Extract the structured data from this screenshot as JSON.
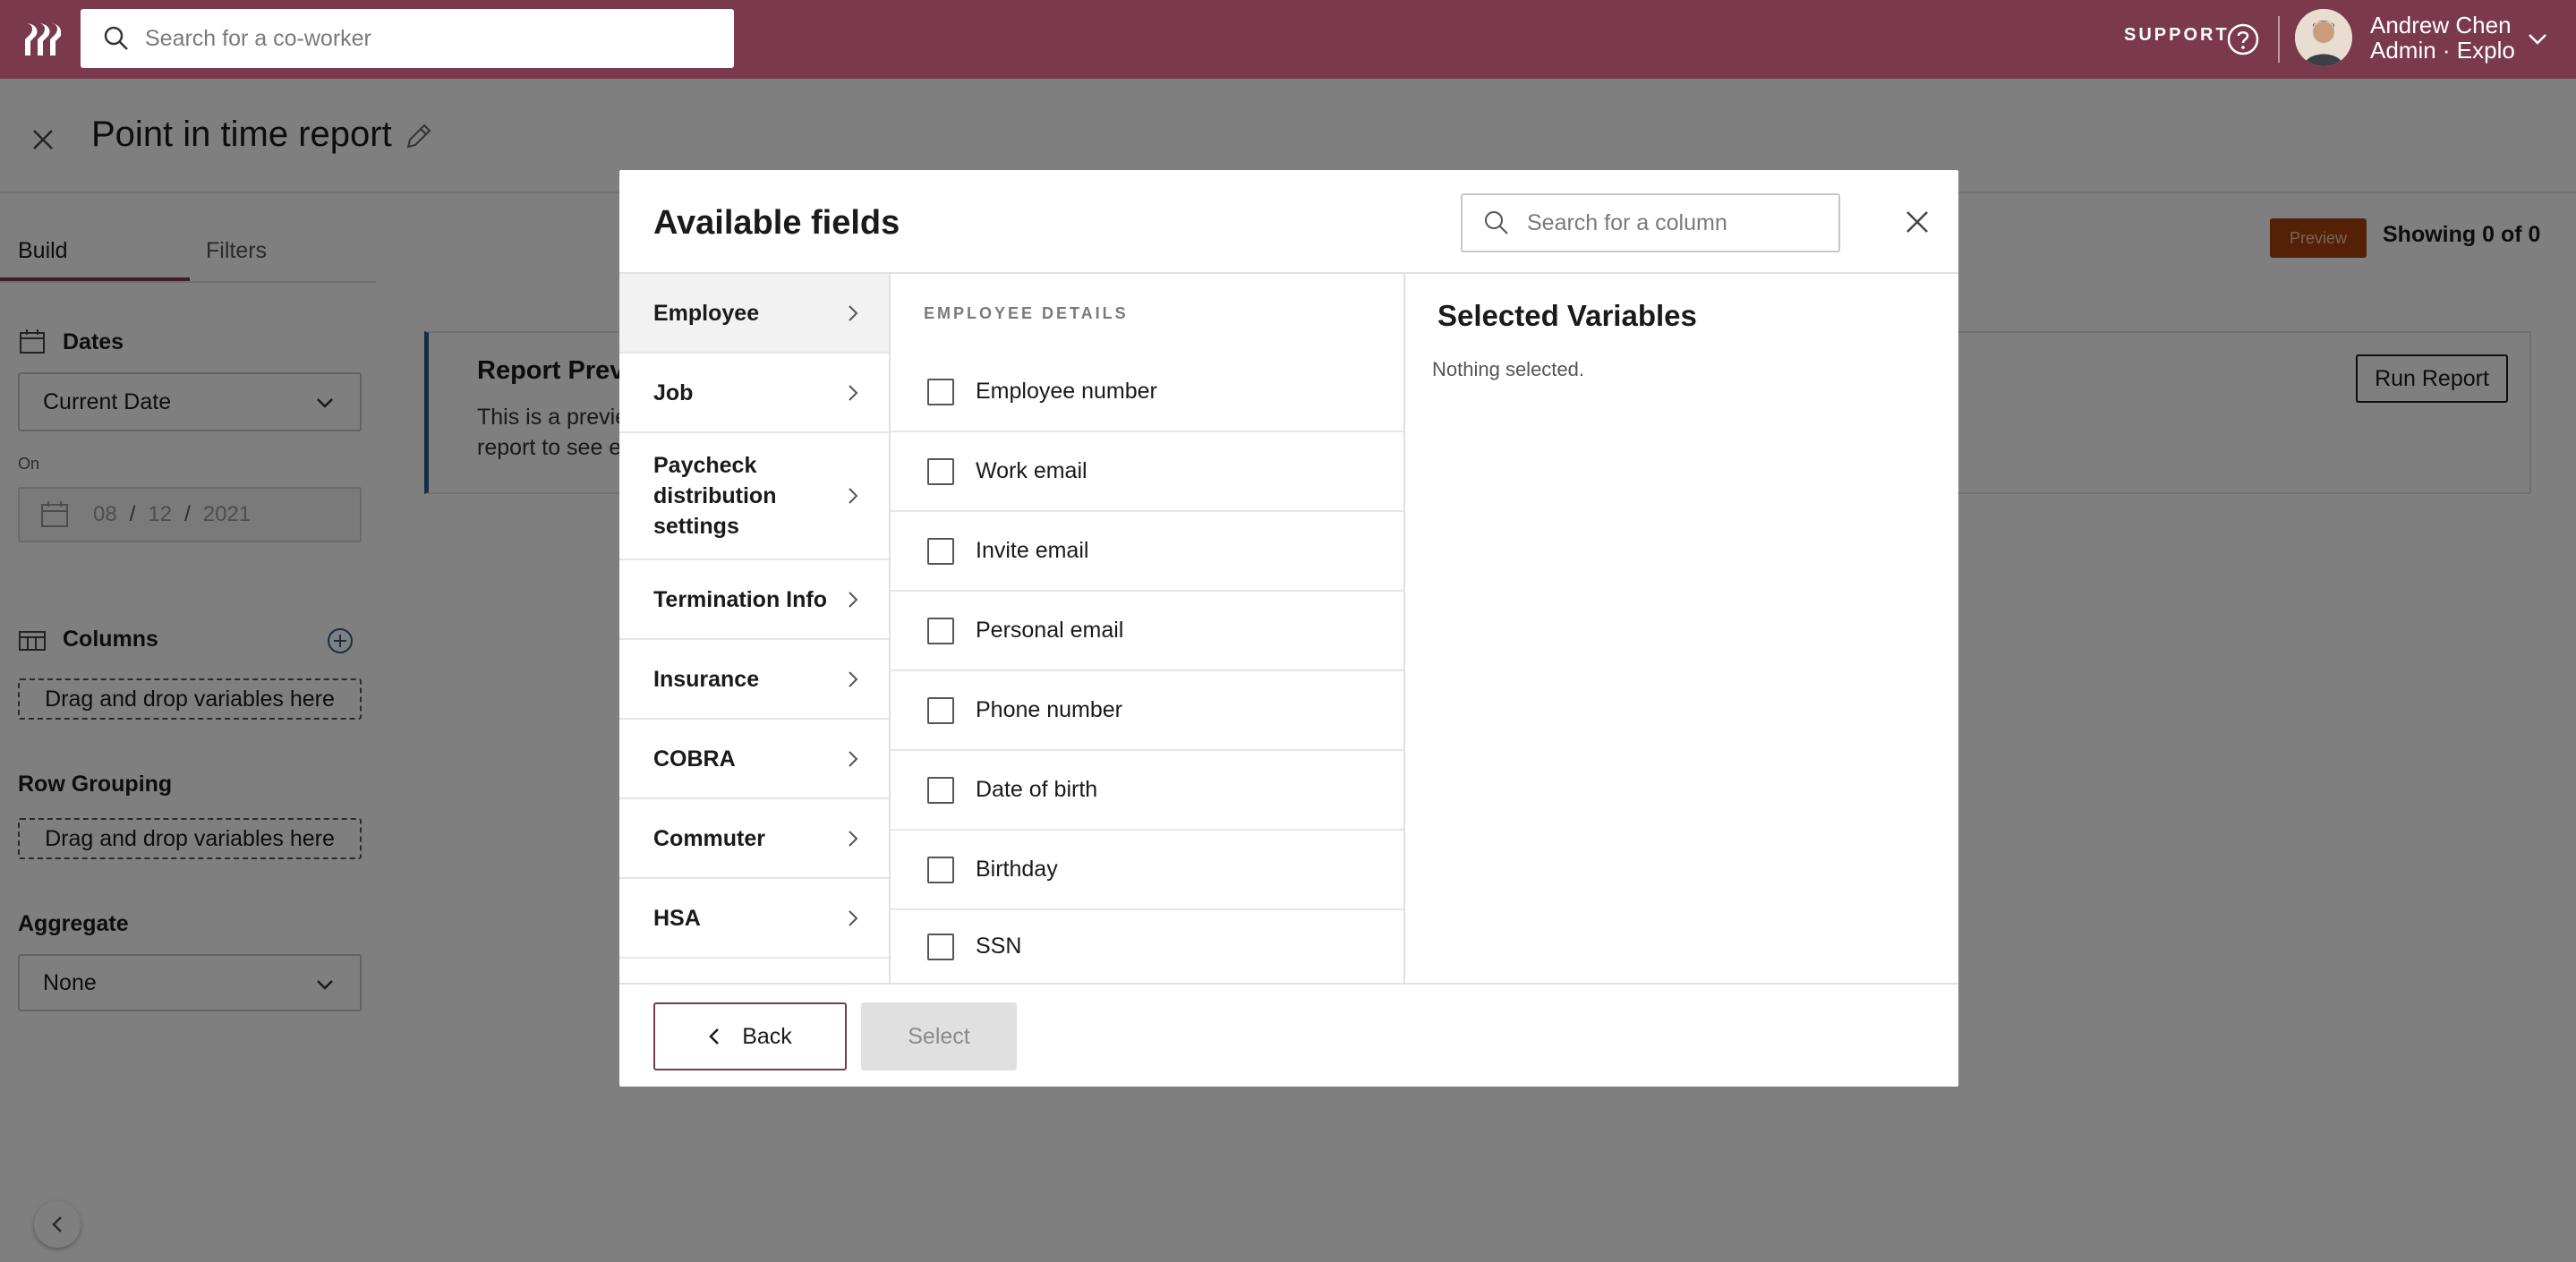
{
  "topbar": {
    "search_placeholder": "Search for a co-worker",
    "support_label": "SUPPORT",
    "user_name": "Andrew Chen",
    "user_role": "Admin · Explo"
  },
  "page": {
    "title": "Point in time report",
    "tabs": {
      "build": "Build",
      "filters": "Filters"
    },
    "dates": {
      "label": "Dates",
      "selected": "Current Date",
      "on_label": "On",
      "month": "08",
      "day": "12",
      "year": "2021"
    },
    "columns": {
      "label": "Columns",
      "drop_text": "Drag and drop variables here"
    },
    "row_grouping": {
      "label": "Row Grouping",
      "drop_text": "Drag and drop variables here"
    },
    "aggregate": {
      "label": "Aggregate",
      "selected": "None"
    },
    "preview_badge": "Preview",
    "showing": "Showing 0 of 0",
    "report_preview": {
      "title": "Report Previe",
      "line1": "This is a previe",
      "line2": "report to see e"
    },
    "run_report": "Run Report"
  },
  "modal": {
    "title": "Available fields",
    "search_placeholder": "Search for a column",
    "categories": [
      {
        "label": "Employee",
        "active": true
      },
      {
        "label": "Job",
        "active": false
      },
      {
        "label": "Paycheck distribution settings",
        "active": false
      },
      {
        "label": "Termination Info",
        "active": false
      },
      {
        "label": "Insurance",
        "active": false
      },
      {
        "label": "COBRA",
        "active": false
      },
      {
        "label": "Commuter",
        "active": false
      },
      {
        "label": "HSA",
        "active": false
      }
    ],
    "fields_heading": "EMPLOYEE DETAILS",
    "fields": [
      {
        "label": "Employee number",
        "checked": false
      },
      {
        "label": "Work email",
        "checked": false
      },
      {
        "label": "Invite email",
        "checked": false
      },
      {
        "label": "Personal email",
        "checked": false
      },
      {
        "label": "Phone number",
        "checked": false
      },
      {
        "label": "Date of birth",
        "checked": false
      },
      {
        "label": "Birthday",
        "checked": false
      },
      {
        "label": "SSN",
        "checked": false
      }
    ],
    "selected_title": "Selected Variables",
    "selected_empty": "Nothing selected.",
    "back_label": "Back",
    "select_label": "Select"
  },
  "colors": {
    "brand": "#7a3a4c",
    "preview_badge": "#a8420f",
    "report_accent": "#2e5a8a"
  }
}
